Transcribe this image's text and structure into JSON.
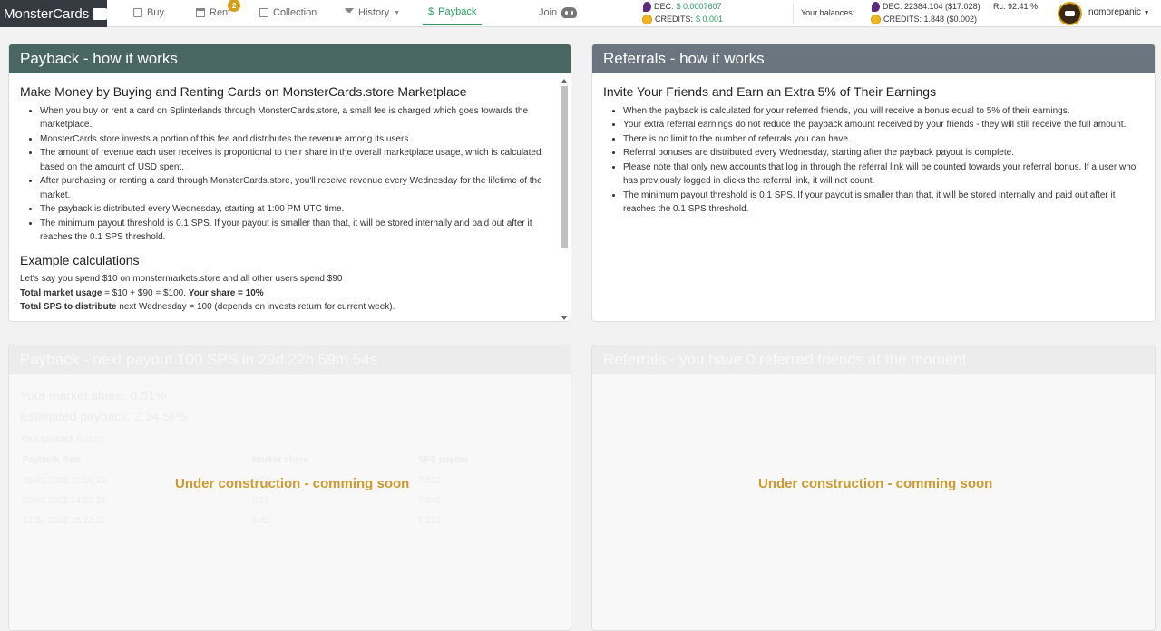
{
  "nav": {
    "brand": "MonsterCards",
    "items": [
      {
        "label": "Buy"
      },
      {
        "label": "Rent",
        "badge": "2"
      },
      {
        "label": "Collection"
      },
      {
        "label": "History"
      },
      {
        "label": "Payback"
      }
    ],
    "join_label": "Join"
  },
  "prices": {
    "dec_label": "DEC:",
    "dec_value": "$ 0.0007607",
    "credits_label": "CREDITS:",
    "credits_value": "$ 0.001"
  },
  "balances": {
    "label": "Your balances:",
    "dec": "DEC: 22384.104 ($17.028)",
    "credits": "CREDITS: 1.848 ($0.002)",
    "rc": "Rc: 92.41 %"
  },
  "user": {
    "name": "nomorepanic"
  },
  "payback_how": {
    "title": "Payback - how it works",
    "heading": "Make Money by Buying and Renting Cards on MonsterCards.store Marketplace",
    "bullets": [
      "When you buy or rent a card on Splinterlands through MonsterCards.store, a small fee is charged which goes towards the marketplace.",
      "MonsterCards.store invests a portion of this fee and distributes the revenue among its users.",
      "The amount of revenue each user receives is proportional to their share in the overall marketplace usage, which is calculated based on the amount of USD spent.",
      "After purchasing or renting a card through MonsterCards.store, you'll receive revenue every Wednesday for the lifetime of the market.",
      "The payback is distributed every Wednesday, starting at 1:00 PM UTC time.",
      "The minimum payout threshold is 0.1 SPS. If your payout is smaller than that, it will be stored internally and paid out after it reaches the 0.1 SPS threshold."
    ],
    "example_heading": "Example calculations",
    "example_line1": "Let's say you spend $10 on monstermarkets.store and all other users spend $90",
    "usage_bold": "Total market usage",
    "usage_rest": " = $10 + $90 = $100. ",
    "share_bold": "Your share = 10%",
    "sps_bold": "Total SPS to distribute",
    "sps_rest": " next Wednesday = 100 (depends on invests return for current week)."
  },
  "referrals_how": {
    "title": "Referrals - how it works",
    "heading": "Invite Your Friends and Earn an Extra 5% of Their Earnings",
    "bullets": [
      "When the payback is calculated for your referred friends, you will receive a bonus equal to 5% of their earnings.",
      "Your extra referral earnings do not reduce the payback amount received by your friends - they will still receive the full amount.",
      "There is no limit to the number of referrals you can have.",
      "Referral bonuses are distributed every Wednesday, starting after the payback payout is complete.",
      "Please note that only new accounts that log in through the referral link will be counted towards your referral bonus. If a user who has previously logged in clicks the referral link, it will not count.",
      "The minimum payout threshold is 0.1 SPS. If your payout is smaller than that, it will be stored internally and paid out after it reaches the 0.1 SPS threshold."
    ]
  },
  "payback_next": {
    "title": "Payback - next payout 100 SPS in 29d 22h 59m 54s",
    "market_share": "Your market share: 0.51%",
    "estimated": "Estimated payback: 2.34 SPS",
    "history_label": "Your payback history:",
    "columns": [
      "Payback date",
      "Market share",
      "SPS payout"
    ],
    "rows": [
      [
        "29.02.2022 13:56:33",
        "0.51",
        "7.522"
      ],
      [
        "05.04.2022 14:53:32",
        "0.51",
        "7.846"
      ],
      [
        "12.04.2022 13:22:22",
        "0.45",
        "7.213"
      ]
    ],
    "under_construction": "Under construction - comming soon"
  },
  "referrals_status": {
    "title": "Referrals  - you have 0 referred friends at the moment",
    "under_construction": "Under construction - comming soon"
  }
}
